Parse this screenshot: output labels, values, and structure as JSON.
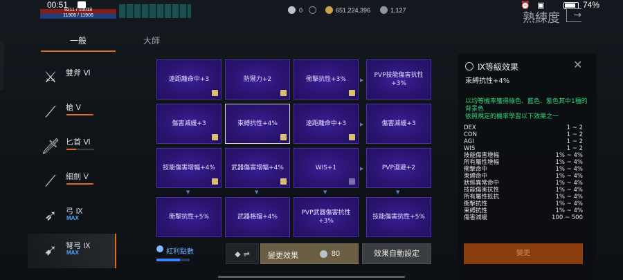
{
  "status": {
    "time": "00:51",
    "hp_text": "9211 / 10018",
    "mp_text": "11906 / 11906",
    "battery": "74%"
  },
  "currency": {
    "diamond": "0",
    "gold": "651,224,396",
    "silver": "1,127"
  },
  "page": {
    "heading": "熟練度"
  },
  "tabs": [
    {
      "label": "一般",
      "active": true
    },
    {
      "label": "大師",
      "active": false
    }
  ],
  "weapons": [
    {
      "icon": "double-axe-icon",
      "name": "雙斧 Ⅵ",
      "badge": "",
      "progress": 0
    },
    {
      "icon": "spear-icon",
      "name": "槍 Ⅴ",
      "badge": "",
      "progress": 0.95
    },
    {
      "icon": "dagger-icon",
      "name": "匕首 Ⅵ",
      "badge": "",
      "progress": 0.35
    },
    {
      "icon": "rapier-icon",
      "name": "細劍 Ⅴ",
      "badge": "",
      "progress": 0.95
    },
    {
      "icon": "bow-icon",
      "name": "弓 Ⅸ",
      "badge": "MAX",
      "progress": 0
    },
    {
      "icon": "crossbow-icon",
      "name": "弩弓 Ⅸ",
      "badge": "MAX",
      "progress": 0
    }
  ],
  "grid": [
    [
      "遠距離命中+3",
      "防禦力+2",
      "衝擊抗性+3%",
      "PVP技能傷害抗性+3%"
    ],
    [
      "傷害減緩+3",
      "束縛抗性+4%",
      "遠距離命中+3",
      "傷害減緩+3"
    ],
    [
      "技能傷害增幅+4%",
      "武器傷害增幅+4%",
      "WIS+1",
      "PVP迴避+2"
    ],
    [
      "衝擊抗性+5%",
      "武器格擋+4%",
      "PVP武器傷害抗性+3%",
      "技能傷害抗性+5%"
    ]
  ],
  "bottom": {
    "points_label": "紅利點數",
    "swap_label": "⇌",
    "change_label": "變更效果",
    "change_cost": "80",
    "auto_label": "效果自動設定"
  },
  "panel": {
    "title": "Ⅸ等級效果",
    "subtitle": "束縛抗性+4%",
    "note": "以均等機率獲得綠色、藍色、紫色其中1種的背景色\n依照規定的機率學習以下效果之一",
    "stats": [
      {
        "k": "DEX",
        "v": "1 ~ 2"
      },
      {
        "k": "CON",
        "v": "1 ~ 2"
      },
      {
        "k": "AGI",
        "v": "1 ~ 2"
      },
      {
        "k": "WIS",
        "v": "1 ~ 2"
      },
      {
        "k": "技能傷害增幅",
        "v": "1% ~ 4%"
      },
      {
        "k": "所有屬性增幅",
        "v": "1% ~ 4%"
      },
      {
        "k": "衝擊命中",
        "v": "1% ~ 4%"
      },
      {
        "k": "束縛命中",
        "v": "1% ~ 4%"
      },
      {
        "k": "狀態異常命中",
        "v": "1% ~ 4%"
      },
      {
        "k": "技能傷害抗性",
        "v": "1% ~ 4%"
      },
      {
        "k": "所有屬性抵抗",
        "v": "1% ~ 4%"
      },
      {
        "k": "衝擊抗性",
        "v": "1% ~ 4%"
      },
      {
        "k": "束縛抗性",
        "v": "1% ~ 4%"
      },
      {
        "k": "傷害減緩",
        "v": "100 ~ 500"
      }
    ],
    "confirm_label": "變更"
  }
}
